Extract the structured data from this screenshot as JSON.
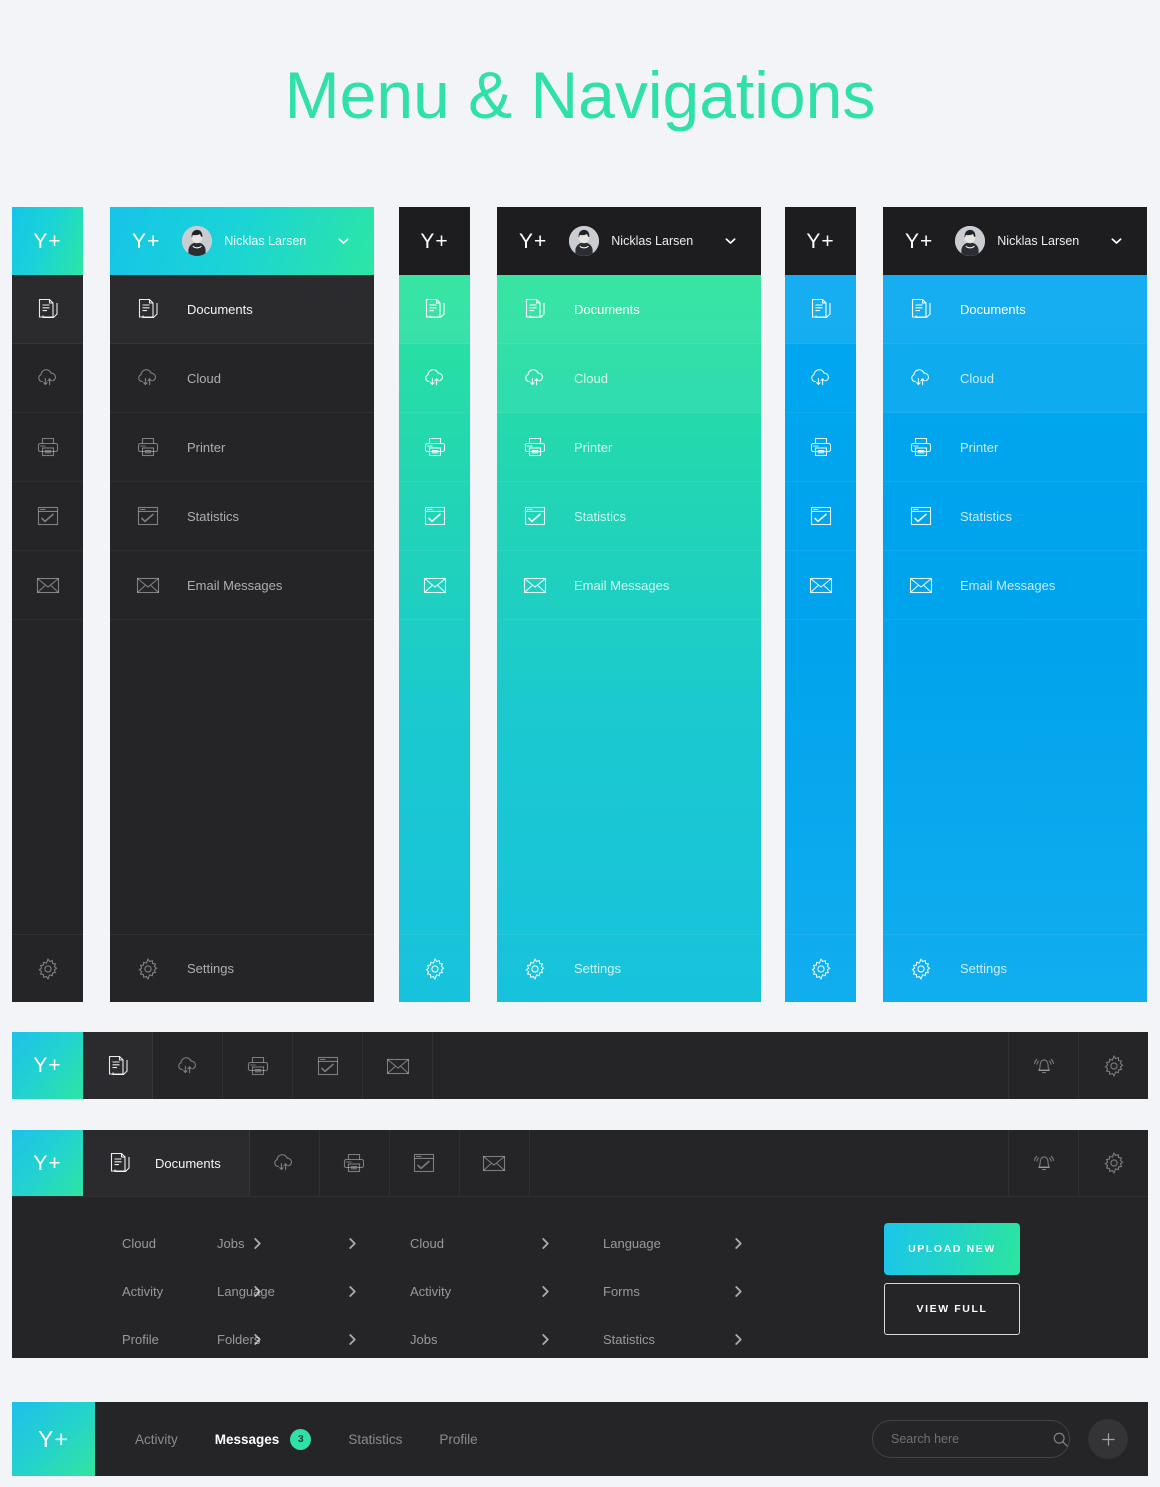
{
  "page": {
    "title": "Menu & Navigations"
  },
  "brand": {
    "logo": "Y+"
  },
  "user": {
    "name": "Nicklas Larsen"
  },
  "menu": {
    "items": [
      {
        "label": "Documents",
        "icon": "documents-icon"
      },
      {
        "label": "Cloud",
        "icon": "cloud-icon"
      },
      {
        "label": "Printer",
        "icon": "printer-icon"
      },
      {
        "label": "Statistics",
        "icon": "statistics-icon"
      },
      {
        "label": "Email Messages",
        "icon": "email-icon"
      }
    ],
    "settings": {
      "label": "Settings",
      "icon": "gear-icon"
    }
  },
  "topbar": {
    "icons": [
      "documents-icon",
      "cloud-icon",
      "printer-icon",
      "statistics-icon",
      "email-icon"
    ],
    "right_icons": [
      "bell-icon",
      "gear-icon"
    ]
  },
  "megamenu": {
    "active_item": "Documents",
    "columns": [
      {
        "links": [
          "Cloud",
          "Activity",
          "Profile"
        ]
      },
      {
        "links": [
          "Jobs",
          "Language",
          "Folders"
        ]
      },
      {
        "links": [
          "Cloud",
          "Activity",
          "Jobs"
        ]
      },
      {
        "links": [
          "Language",
          "Forms",
          "Statistics"
        ]
      }
    ],
    "buttons": {
      "primary": "UPLOAD NEW",
      "secondary": "VIEW FULL"
    }
  },
  "bottombar": {
    "items": [
      {
        "label": "Activity",
        "badge": null
      },
      {
        "label": "Messages",
        "badge": "3"
      },
      {
        "label": "Statistics",
        "badge": null
      },
      {
        "label": "Profile",
        "badge": null
      }
    ],
    "search": {
      "placeholder": "Search here",
      "value": ""
    },
    "add_label": "+"
  },
  "colors": {
    "accent_green": "#2fe0a8",
    "accent_cyan": "#16c4e8",
    "accent_blue": "#00a3ec",
    "dark": "#252527",
    "darker": "#1d1d1f",
    "page_bg": "#f2f4f7"
  }
}
